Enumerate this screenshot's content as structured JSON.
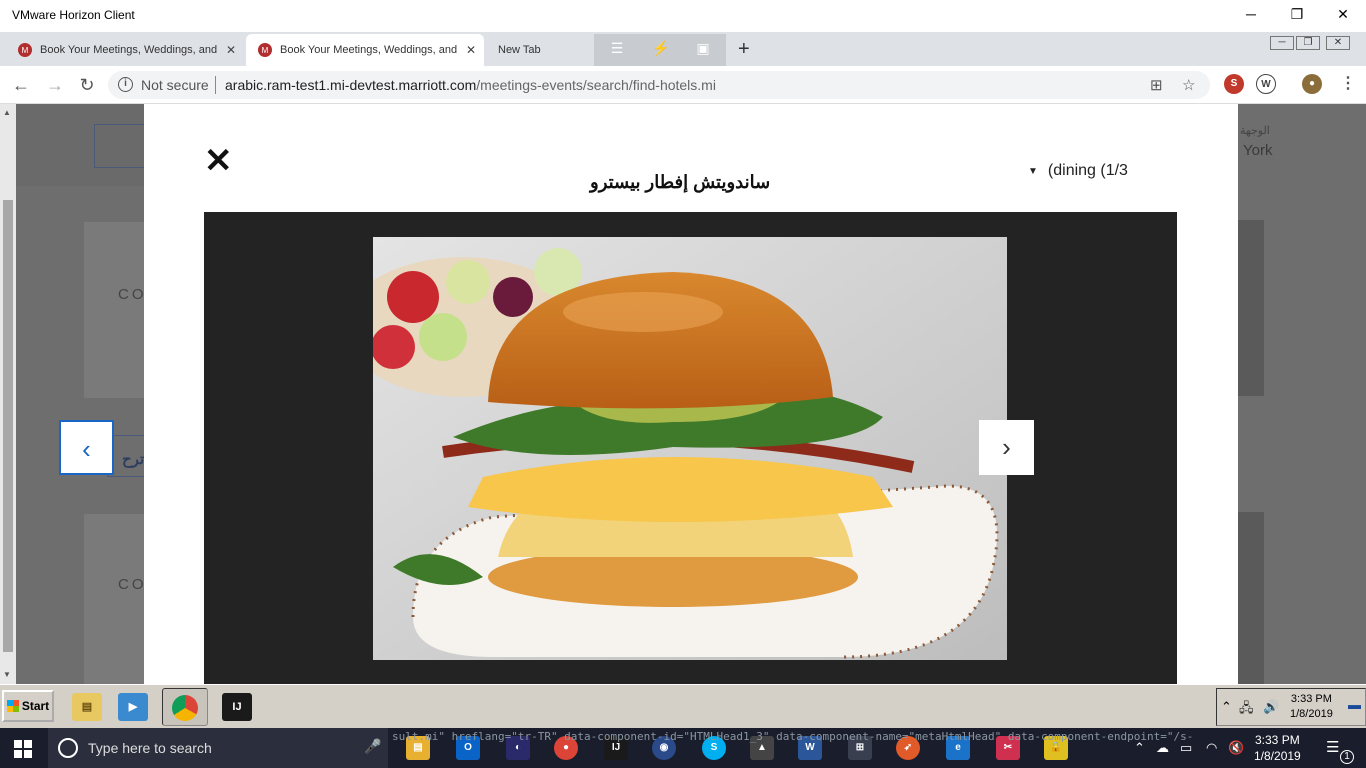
{
  "vm": {
    "title": "VMware Horizon Client",
    "minimize": "─",
    "restore": "❐",
    "close": "✕"
  },
  "tabs": [
    {
      "label": "Book Your Meetings, Weddings, and"
    },
    {
      "label": "Book Your Meetings, Weddings, and"
    },
    {
      "label": "New Tab"
    }
  ],
  "address": {
    "not_secure": "Not secure",
    "host": "arabic.ram-test1.mi-devtest.marriott.com",
    "path": "/meetings-events/search/find-hotels.mi"
  },
  "background": {
    "co_1": "CO",
    "co_2": "CO",
    "arabic_partial": "ترح",
    "right_top": "الوجهة",
    "right_york": "York"
  },
  "modal": {
    "title": "ساندويتش إفطار بيسترو",
    "dining": "(dining (1/3",
    "close": "✕",
    "prev": "‹",
    "next": "›"
  },
  "inner_taskbar": {
    "start": "Start",
    "time": "3:33 PM",
    "date": "1/8/2019"
  },
  "win_taskbar": {
    "search_placeholder": "Type here to search",
    "time": "3:33 PM",
    "date": "1/8/2019",
    "notifications": "1",
    "overlay_code": "sult.mi\" hreflang=\"tr-TR\" data-component-id=\"HTMLHead1_3\" data-component-name=\"metaHtmlHead\" data-component-endpoint=\"/s-"
  },
  "colors": {
    "accent_blue": "#1a66c4",
    "marriott_red": "#b22d30"
  }
}
